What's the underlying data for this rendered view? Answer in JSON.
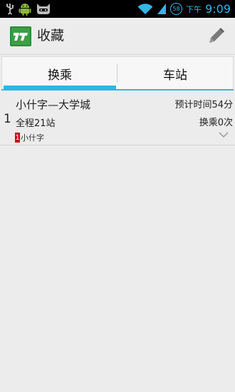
{
  "status_bar": {
    "ampm": "下午",
    "time": "9:09",
    "battery_level": "58",
    "icons": [
      "usb-icon",
      "android-icon",
      "cyanogen-icon",
      "wifi-icon",
      "signal-icon",
      "battery-icon"
    ]
  },
  "action_bar": {
    "title": "收藏",
    "app_icon": "route-logo-icon",
    "edit_icon": "pencil-icon"
  },
  "tabs": [
    {
      "label": "换乘",
      "active": true
    },
    {
      "label": "车站",
      "active": false
    }
  ],
  "colors": {
    "accent": "#33b5e5",
    "line_badge": "#d0021b",
    "app_icon": "#2e8b3a"
  },
  "routes": [
    {
      "index": "1",
      "name": "小什字—大学城",
      "time": "预计时间54分",
      "stops": "全程21站",
      "transfers": "换乘0次",
      "line_number": "1",
      "line_name": "小什字"
    }
  ]
}
